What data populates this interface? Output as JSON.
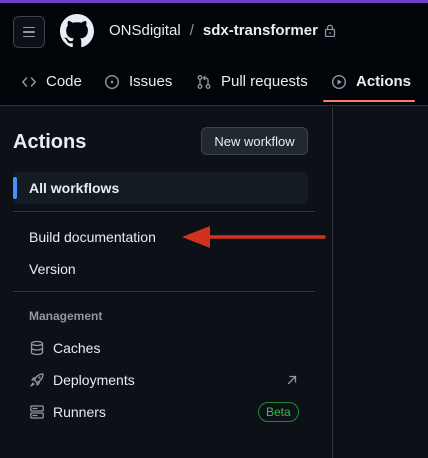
{
  "repo": {
    "owner": "ONSdigital",
    "separator": "/",
    "name": "sdx-transformer",
    "visibility_icon": "lock-icon"
  },
  "tabs": [
    {
      "label": "Code",
      "icon": "code-icon"
    },
    {
      "label": "Issues",
      "icon": "issue-icon"
    },
    {
      "label": "Pull requests",
      "icon": "pull-request-icon"
    },
    {
      "label": "Actions",
      "icon": "play-icon",
      "active": true
    }
  ],
  "sidebar": {
    "title": "Actions",
    "new_workflow_label": "New workflow",
    "all_workflows_label": "All workflows",
    "workflows": [
      "Build documentation",
      "Version"
    ],
    "management_heading": "Management",
    "management_items": [
      {
        "label": "Caches",
        "icon": "database-icon"
      },
      {
        "label": "Deployments",
        "icon": "rocket-icon",
        "trailing_icon": "arrow-up-right-icon"
      },
      {
        "label": "Runners",
        "icon": "server-icon",
        "badge": "Beta"
      }
    ]
  },
  "colors": {
    "accent_underline": "#f78166",
    "selected_bar": "#4493f8",
    "annotation_arrow": "#d0321e",
    "beta_badge": "#3fb950"
  }
}
